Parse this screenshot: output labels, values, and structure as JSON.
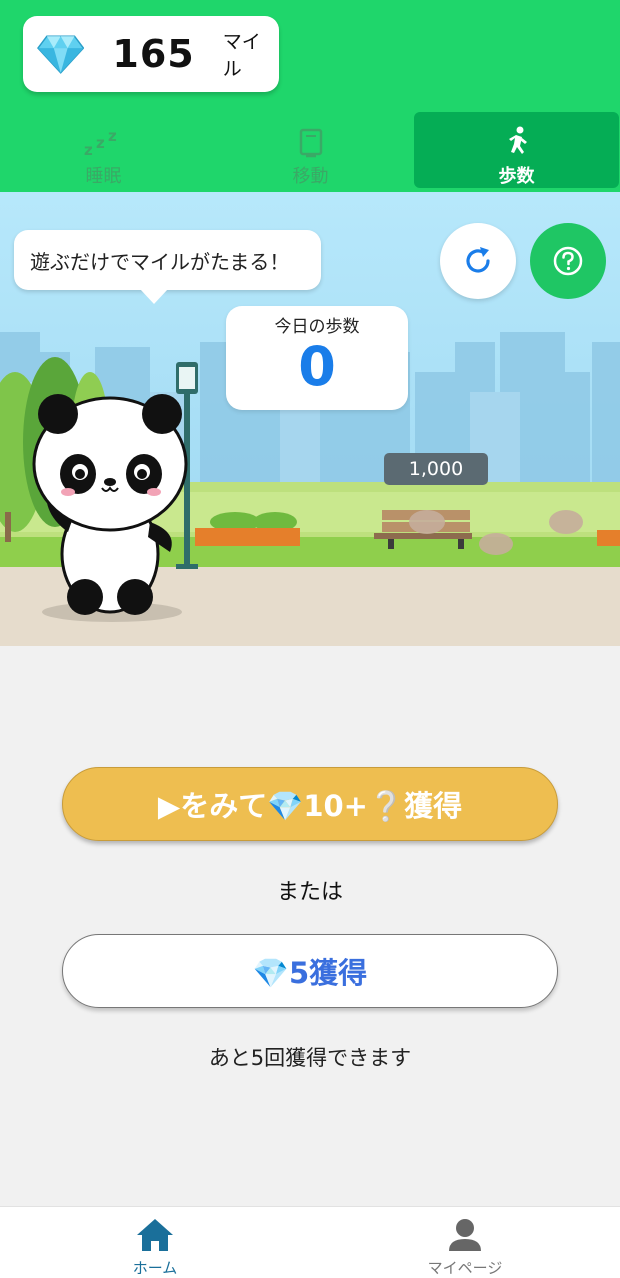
{
  "header": {
    "miles_value": "165",
    "miles_unit": "マイル",
    "tabs": [
      {
        "label": "睡眠",
        "icon": "sleep-zzz-icon"
      },
      {
        "label": "移動",
        "icon": "move-icon"
      },
      {
        "label": "歩数",
        "icon": "walking-person-icon"
      }
    ],
    "active_tab": "歩数"
  },
  "scene": {
    "speech_bubble": "遊ぶだけでマイルがたまる！",
    "steps_title": "今日の歩数",
    "steps_value": "0",
    "goal_marker": "1,000"
  },
  "actions": {
    "watch_button": "▶をみて💎10+❔獲得",
    "or_text": "または",
    "get_button": "💎5獲得",
    "remaining_text": "あと5回獲得できます"
  },
  "bottom_nav": {
    "home_label": "ホーム",
    "mypage_label": "マイページ"
  },
  "colors": {
    "header_green": "#1fd66b",
    "active_tab_green": "#05ad55",
    "steps_blue": "#1a7de9",
    "watch_button_yellow": "#eebe50",
    "get_button_text": "#3a6fde",
    "nav_active": "#1a6f9a",
    "nav_inactive": "#777777"
  }
}
